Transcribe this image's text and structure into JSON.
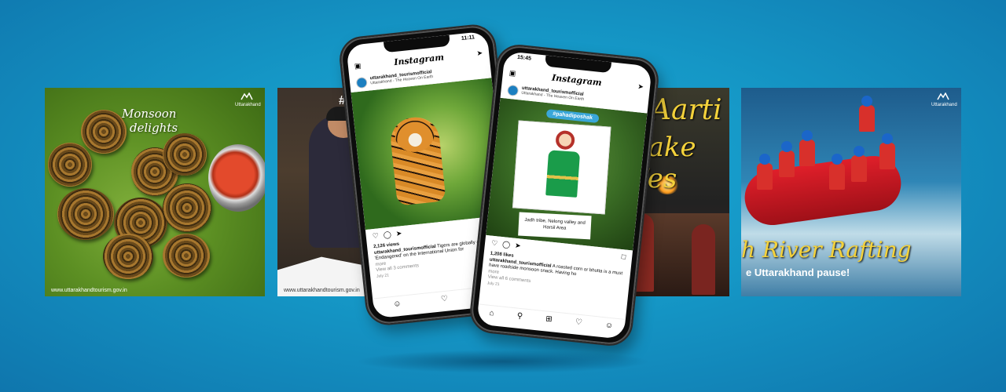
{
  "cards": {
    "monsoon": {
      "title_line1": "Monsoon",
      "title_line2": "delights",
      "watermark": "www.uttarakhandtourism.gov.in",
      "logo_text": "Uttarakhand"
    },
    "artisan": {
      "hashtag": "#Arti",
      "watermark": "www.uttarakhandtourism.gov.in"
    },
    "aarti": {
      "line1": "Aarti",
      "line2": "Lake Fes"
    },
    "rafting": {
      "title": "h River Rafting",
      "subtitle": "e Uttarakhand pause!",
      "logo_text": "Uttarakhand"
    }
  },
  "phone_left": {
    "time": "11:11",
    "app_title": "Instagram",
    "username": "uttarakhand_tourismofficial",
    "subtitle": "Uttarakhand - The Heaven On Earth",
    "views": "2,126 views",
    "caption_user": "uttarakhand_tourismofficial",
    "caption_text": "Tigers are globally as 'Endangered' on the International Union for",
    "more": "more",
    "comments": "View all 3 comments",
    "date": "July 21"
  },
  "phone_right": {
    "time": "15:45",
    "app_title": "Instagram",
    "username": "uttarakhand_tourismofficial",
    "subtitle": "Uttarakhand - The Heaven On Earth",
    "tag": "#pahadiposhak",
    "note": "Jadh tribe, Nelong valley and Harsil Area",
    "likes": "1,208 likes",
    "caption_user": "uttarakhand_tourismofficial",
    "caption_text": "A roasted corn or bhutta is a must have roadside monsoon snack. Having ho",
    "more": "more",
    "comments": "View all 6 comments",
    "date": "July 21"
  }
}
